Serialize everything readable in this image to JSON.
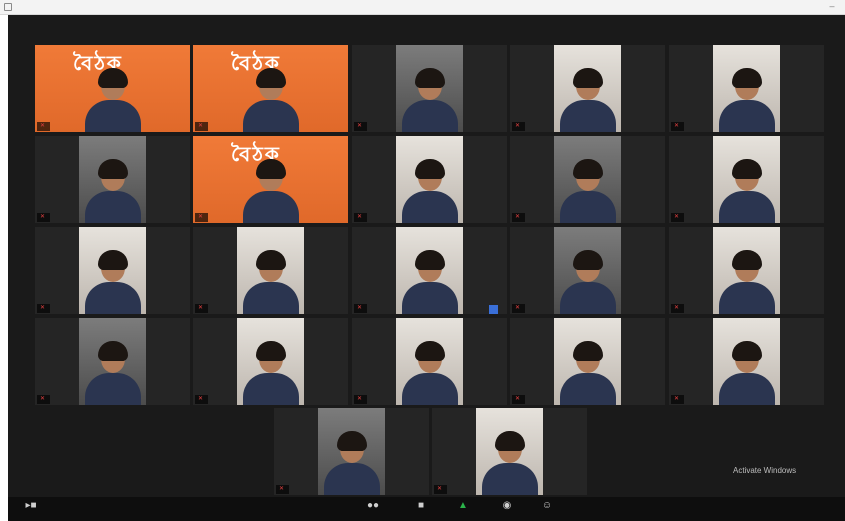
{
  "window": {
    "title_icon": "zoom-app-icon",
    "minimize_label": "–"
  },
  "banner_text": "বৈঠক",
  "tiles": [
    {
      "name": "",
      "style": "banner"
    },
    {
      "name": "",
      "style": "banner",
      "active": true
    },
    {
      "name": "",
      "style": "room"
    },
    {
      "name": "",
      "style": "bright"
    },
    {
      "name": "",
      "style": "bright"
    },
    {
      "name": "",
      "style": "room"
    },
    {
      "name": "",
      "style": "banner"
    },
    {
      "name": "",
      "style": "bright"
    },
    {
      "name": "",
      "style": "room"
    },
    {
      "name": "",
      "style": "bright"
    },
    {
      "name": "",
      "style": "bright"
    },
    {
      "name": "",
      "style": "bright"
    },
    {
      "name": "",
      "style": "bright"
    },
    {
      "name": "",
      "style": "room"
    },
    {
      "name": "",
      "style": "bright"
    },
    {
      "name": "",
      "style": "room"
    },
    {
      "name": "",
      "style": "bright"
    },
    {
      "name": "",
      "style": "bright"
    },
    {
      "name": "",
      "style": "bright"
    },
    {
      "name": "",
      "style": "bright"
    },
    {
      "name": "",
      "style": "room"
    },
    {
      "name": "",
      "style": "bright"
    }
  ],
  "watermark": {
    "line1": "Activate Windows",
    "line2": ""
  },
  "toolbar": {
    "video": {
      "icon": "video-camera-icon",
      "label": ""
    },
    "participants": {
      "icon": "participants-icon",
      "label": ""
    },
    "chat": {
      "icon": "chat-icon",
      "label": ""
    },
    "share": {
      "icon": "share-screen-icon",
      "label": ""
    },
    "record": {
      "icon": "record-icon",
      "label": ""
    },
    "reactions": {
      "icon": "reactions-icon",
      "label": ""
    }
  }
}
